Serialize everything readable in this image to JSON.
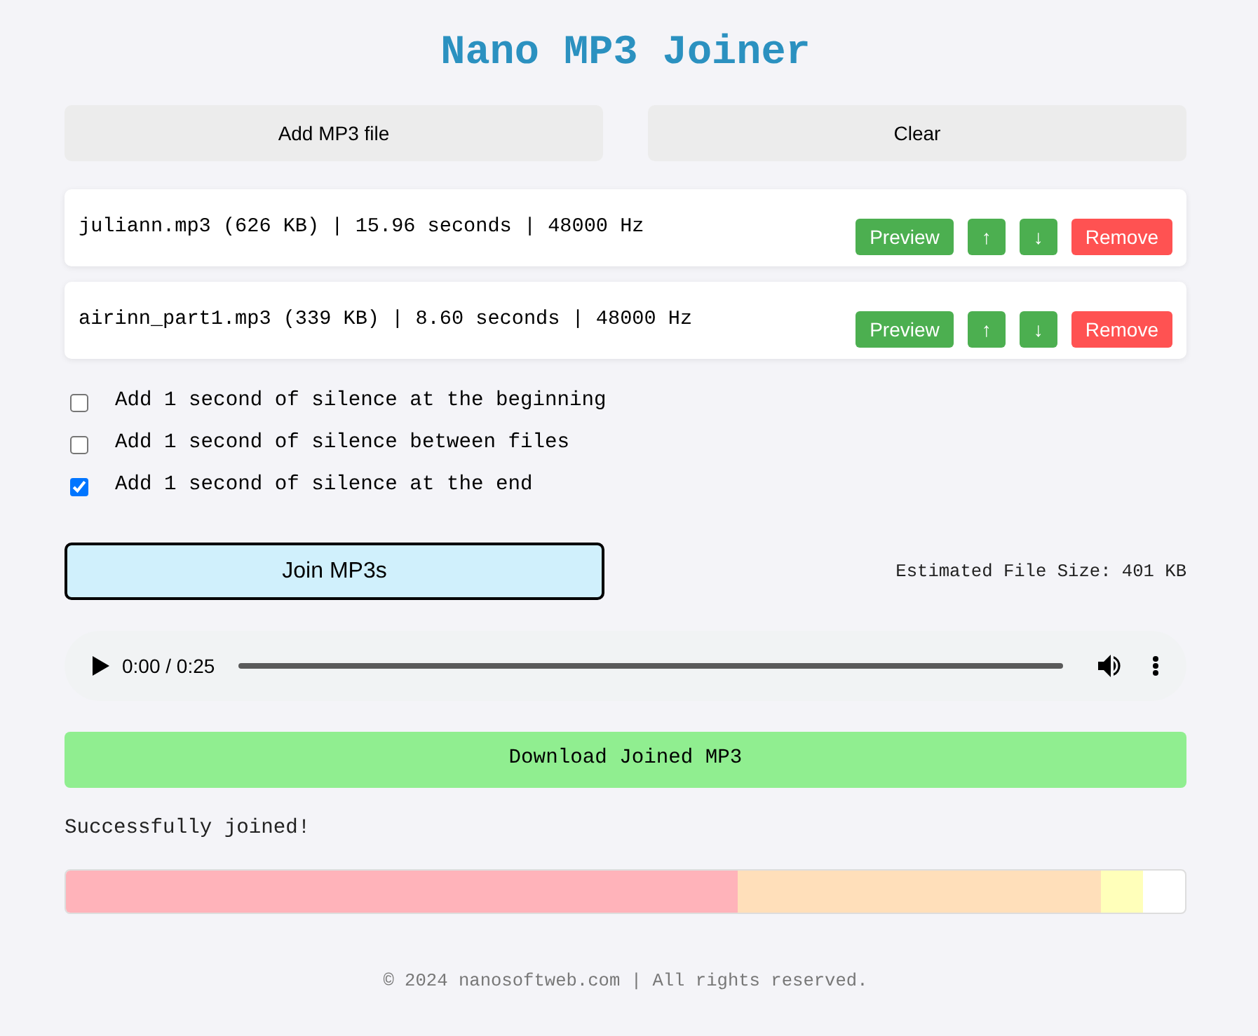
{
  "title": "Nano MP3 Joiner",
  "toolbar": [
    {
      "label": "Add MP3 file"
    },
    {
      "label": "Clear"
    }
  ],
  "files": [
    {
      "info": "juliann.mp3 (626 KB) | 15.96 seconds | 48000 Hz",
      "buttons": [
        {
          "kind": "preview",
          "label": "Preview"
        },
        {
          "kind": "up",
          "label": "↑"
        },
        {
          "kind": "down",
          "label": "↓"
        },
        {
          "kind": "remove",
          "label": "Remove"
        }
      ]
    },
    {
      "info": "airinn_part1.mp3 (339 KB) | 8.60 seconds | 48000 Hz",
      "buttons": [
        {
          "kind": "preview",
          "label": "Preview"
        },
        {
          "kind": "up",
          "label": "↑"
        },
        {
          "kind": "down",
          "label": "↓"
        },
        {
          "kind": "remove",
          "label": "Remove"
        }
      ]
    }
  ],
  "options": [
    {
      "label": "Add 1 second of silence at the beginning",
      "checked": false
    },
    {
      "label": "Add 1 second of silence between files",
      "checked": false
    },
    {
      "label": "Add 1 second of silence at the end",
      "checked": true
    }
  ],
  "join_button": {
    "label": "Join MP3s"
  },
  "estimate": "Estimated File Size: 401 KB",
  "player": {
    "time": "0:00 / 0:25"
  },
  "download_button": {
    "label": "Download Joined MP3"
  },
  "status": "Successfully joined!",
  "timeline": {
    "segments": [
      {
        "color": "#ffb3ba"
      },
      {
        "color": "#ffdfba"
      },
      {
        "color": "#ffffba"
      }
    ]
  },
  "footer": "© 2024 nanosoftweb.com | All rights reserved."
}
